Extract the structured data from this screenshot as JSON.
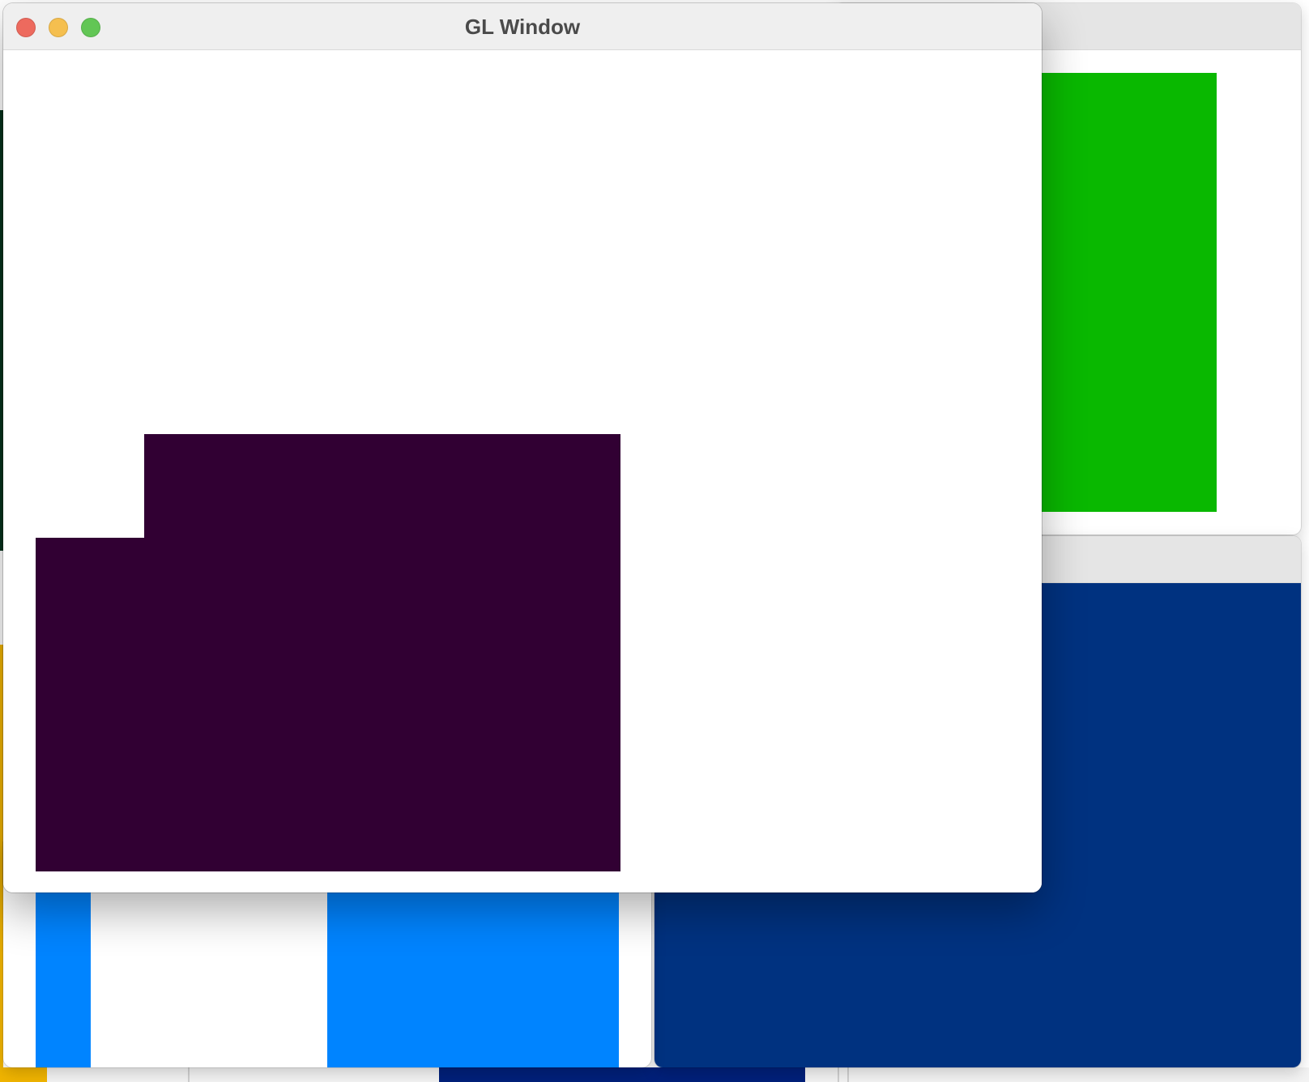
{
  "main_window": {
    "title": "GL Window"
  },
  "colors": {
    "canvas_shape": "#310033",
    "green_rect": "#09b800",
    "blue_rect": "#0084ff",
    "navy_fill": "#003280",
    "yellow_sliver": "#f0b400",
    "dark_green_sliver": "#05321c"
  },
  "icons": [
    "close-icon",
    "minimize-icon",
    "maximize-icon"
  ]
}
